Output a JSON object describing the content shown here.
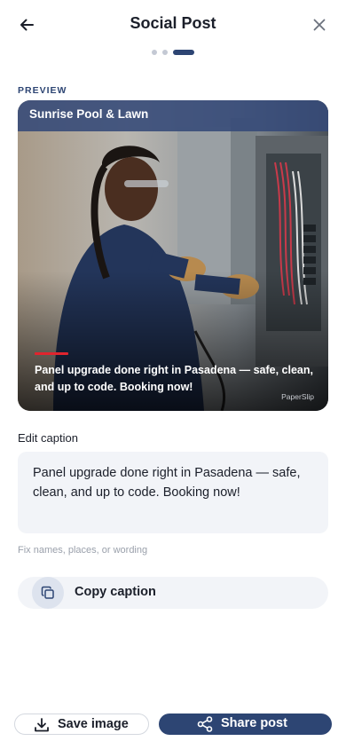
{
  "header": {
    "title": "Social Post",
    "back_icon": "arrow-left-icon",
    "close_icon": "close-icon"
  },
  "steps": {
    "total": 3,
    "current": 3
  },
  "preview": {
    "section_label": "PREVIEW",
    "business_name": "Sunrise Pool & Lawn",
    "overlay_caption": "Panel upgrade done right in Pasadena — safe, clean, and up to code. Booking now!",
    "watermark": "PaperSlip",
    "accent_color": "#e0242e",
    "banner_color": "#344978"
  },
  "editor": {
    "label": "Edit caption",
    "caption_value": "Panel upgrade done right in Pasadena — safe, clean, and up to code. Booking now!",
    "hint": "Fix names, places, or wording"
  },
  "copy": {
    "label": "Copy caption",
    "icon": "copy-icon"
  },
  "actions": {
    "save_label": "Save image",
    "save_icon": "download-icon",
    "share_label": "Share post",
    "share_icon": "share-icon",
    "primary_color": "#2d4573"
  }
}
